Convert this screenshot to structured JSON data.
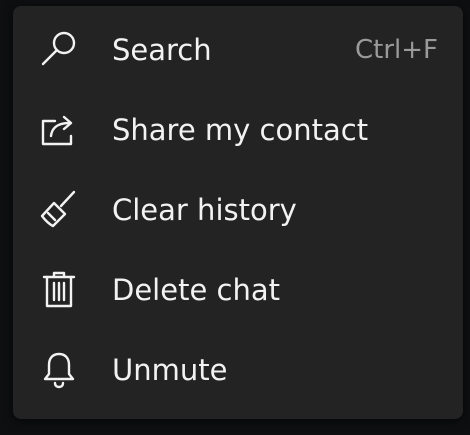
{
  "menu": {
    "items": [
      {
        "label": "Search",
        "shortcut": "Ctrl+F",
        "icon": "search-icon"
      },
      {
        "label": "Share my contact",
        "icon": "share-icon"
      },
      {
        "label": "Clear history",
        "icon": "broom-icon"
      },
      {
        "label": "Delete chat",
        "icon": "trash-icon"
      },
      {
        "label": "Unmute",
        "icon": "bell-icon"
      }
    ]
  },
  "colors": {
    "menu_background": "#232323",
    "text": "#f2f2f2",
    "shortcut_text": "#9a9a9a"
  }
}
